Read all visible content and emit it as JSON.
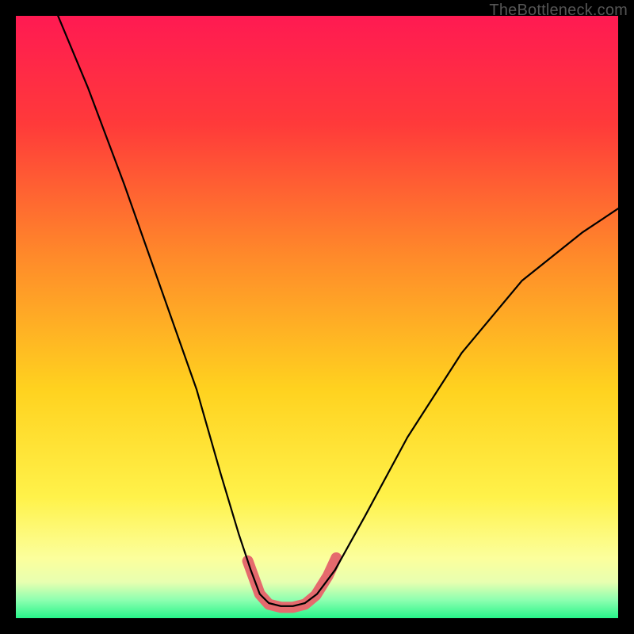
{
  "watermark": "TheBottleneck.com",
  "chart_data": {
    "type": "line",
    "title": "",
    "xlabel": "",
    "ylabel": "",
    "xlim": [
      0,
      100
    ],
    "ylim": [
      0,
      100
    ],
    "grid": false,
    "legend": false,
    "gradient_stops": [
      {
        "pct": 0,
        "color": "#ff1a52"
      },
      {
        "pct": 18,
        "color": "#ff3a3a"
      },
      {
        "pct": 40,
        "color": "#ff8a2a"
      },
      {
        "pct": 62,
        "color": "#ffd21f"
      },
      {
        "pct": 80,
        "color": "#fff24a"
      },
      {
        "pct": 90,
        "color": "#fcff9c"
      },
      {
        "pct": 94,
        "color": "#e8ffb0"
      },
      {
        "pct": 97,
        "color": "#8dffb0"
      },
      {
        "pct": 100,
        "color": "#27f58a"
      }
    ],
    "series": [
      {
        "name": "bottleneck-curve",
        "stroke": "#000000",
        "stroke_width": 2.2,
        "path_xy": [
          [
            7,
            100
          ],
          [
            12,
            88
          ],
          [
            18,
            72
          ],
          [
            24,
            55
          ],
          [
            30,
            38
          ],
          [
            34,
            24
          ],
          [
            37,
            14
          ],
          [
            39,
            8
          ],
          [
            40.5,
            4
          ],
          [
            42,
            2.5
          ],
          [
            44,
            2
          ],
          [
            46,
            2
          ],
          [
            48,
            2.5
          ],
          [
            50,
            4
          ],
          [
            53,
            8
          ],
          [
            58,
            17
          ],
          [
            65,
            30
          ],
          [
            74,
            44
          ],
          [
            84,
            56
          ],
          [
            94,
            64
          ],
          [
            100,
            68
          ]
        ]
      },
      {
        "name": "highlight-segment",
        "stroke": "#e56a6d",
        "stroke_width": 14,
        "linecap": "round",
        "path_xy": [
          [
            38.5,
            9.5
          ],
          [
            40.5,
            4
          ],
          [
            42,
            2.3
          ],
          [
            44,
            1.8
          ],
          [
            46,
            1.8
          ],
          [
            48,
            2.3
          ],
          [
            49.8,
            3.8
          ],
          [
            51.8,
            7.0
          ],
          [
            53.2,
            10.0
          ]
        ]
      }
    ]
  }
}
